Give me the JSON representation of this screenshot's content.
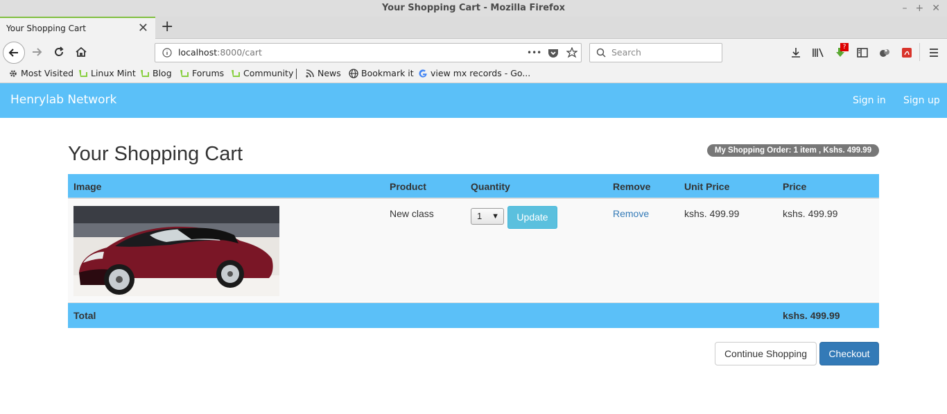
{
  "window": {
    "title": "Your Shopping Cart - Mozilla Firefox",
    "controls": [
      "–",
      "+",
      "✕"
    ]
  },
  "tabs": [
    {
      "label": "Your Shopping Cart",
      "close": "✕"
    }
  ],
  "new_tab": "+",
  "urlbar": {
    "host": "localhost",
    "path": ":8000/cart",
    "more": "•••"
  },
  "search": {
    "placeholder": "Search"
  },
  "toolbar": {
    "badge": "?"
  },
  "bookmarks": [
    {
      "label": "Most Visited",
      "icon": "gear-icon"
    },
    {
      "label": "Linux Mint",
      "icon": "mint-icon"
    },
    {
      "label": "Blog",
      "icon": "mint-icon"
    },
    {
      "label": "Forums",
      "icon": "mint-icon"
    },
    {
      "label": "Community",
      "icon": "mint-icon"
    },
    {
      "label": "News",
      "icon": "rss-icon"
    },
    {
      "label": "Bookmark it",
      "icon": "globe-icon"
    },
    {
      "label": "view mx records - Go...",
      "icon": "google-icon"
    }
  ],
  "site": {
    "brand": "Henrylab Network",
    "sign_in": "Sign in",
    "sign_up": "Sign up"
  },
  "page": {
    "title": "Your Shopping Cart",
    "order_badge": "My Shopping Order: 1 item , Kshs. 499.99"
  },
  "table": {
    "headers": [
      "Image",
      "Product",
      "Quantity",
      "Remove",
      "Unit Price",
      "Price"
    ],
    "rows": [
      {
        "product": "New class",
        "quantity": "1",
        "update": "Update",
        "remove": "Remove",
        "unit_price": "kshs. 499.99",
        "price": "kshs. 499.99"
      }
    ],
    "total_label": "Total",
    "total_value": "kshs. 499.99"
  },
  "actions": {
    "continue": "Continue Shopping",
    "checkout": "Checkout"
  },
  "colors": {
    "nav": "#5bc0f8",
    "checkout": "#337ab7",
    "update": "#5bc0de",
    "badge": "#777777"
  }
}
